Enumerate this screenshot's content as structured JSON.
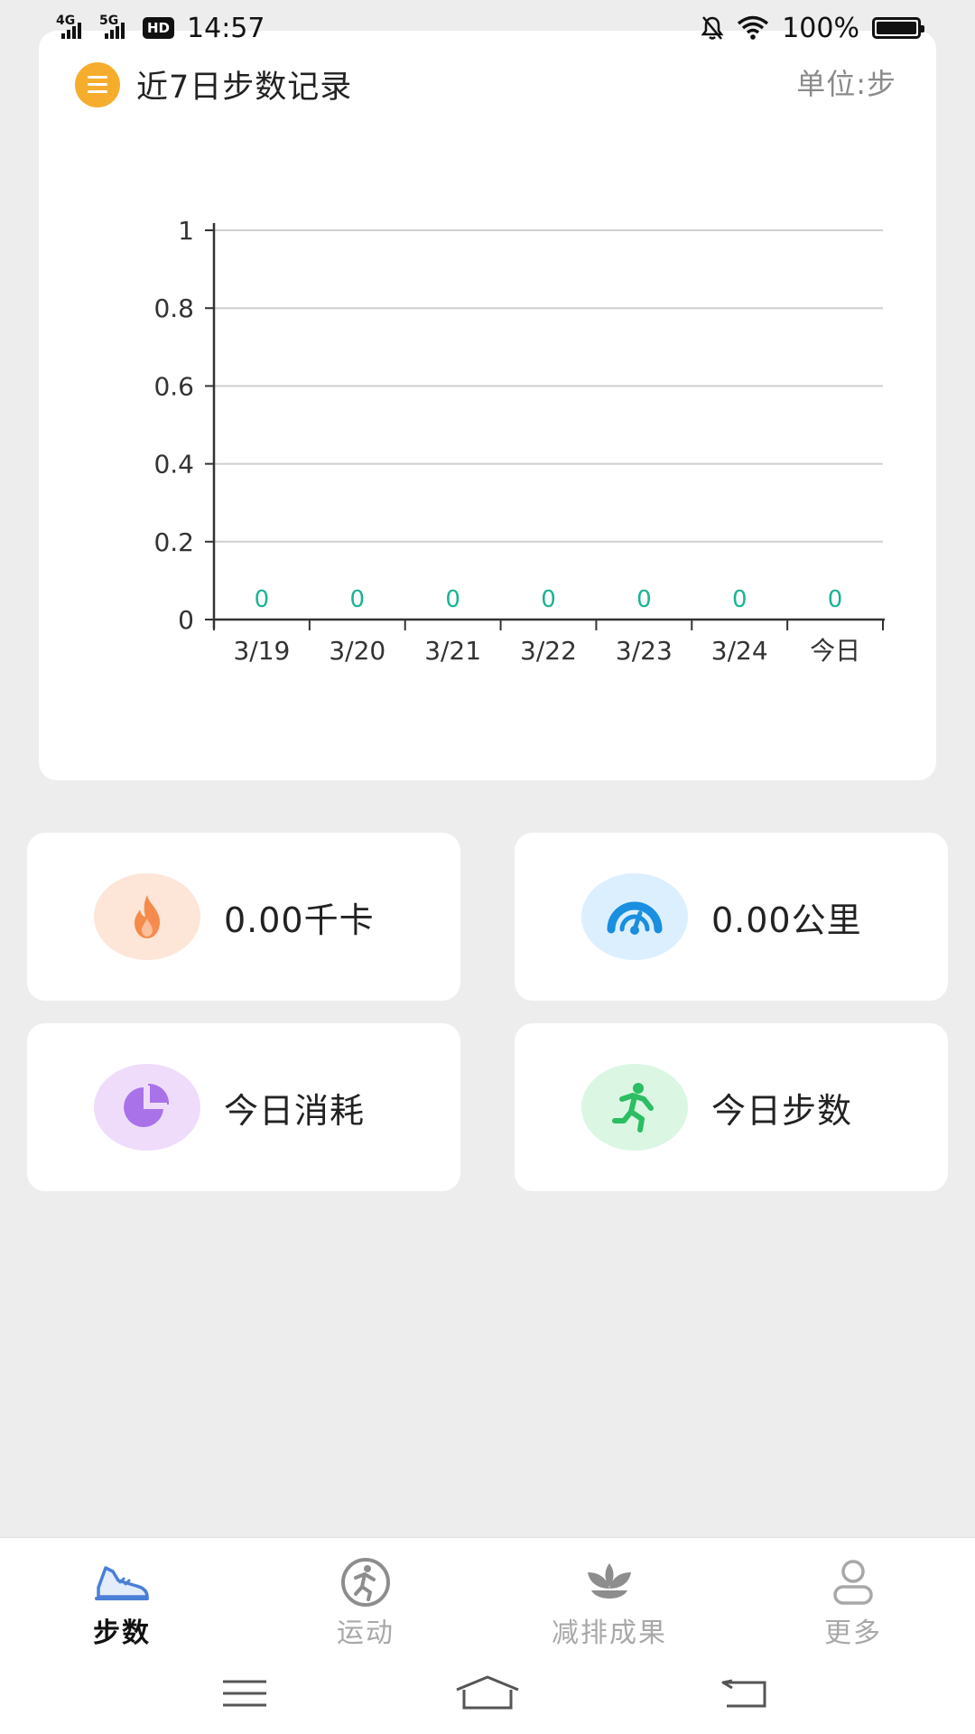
{
  "status_bar": {
    "net1": "4G",
    "net2": "5G",
    "hd": "HD",
    "time": "14:57",
    "battery": "100%"
  },
  "chart_card": {
    "title": "近7日步数记录",
    "unit": "单位:步"
  },
  "chart_data": {
    "type": "bar",
    "categories": [
      "3/19",
      "3/20",
      "3/21",
      "3/22",
      "3/23",
      "3/24",
      "今日"
    ],
    "values": [
      0,
      0,
      0,
      0,
      0,
      0,
      0
    ],
    "data_labels": [
      "0",
      "0",
      "0",
      "0",
      "0",
      "0",
      "0"
    ],
    "yticks": [
      "0",
      "0.2",
      "0.4",
      "0.6",
      "0.8",
      "1"
    ],
    "ylim": [
      0,
      1
    ],
    "grid": true,
    "label_color": "#1ab394"
  },
  "stats": {
    "calories": "0.00千卡",
    "distance": "0.00公里",
    "consumption": "今日消耗",
    "steps": "今日步数"
  },
  "tabs": [
    {
      "label": "步数",
      "icon": "shoe-icon",
      "active": true
    },
    {
      "label": "运动",
      "icon": "run-icon",
      "active": false
    },
    {
      "label": "减排成果",
      "icon": "leaf-icon",
      "active": false
    },
    {
      "label": "更多",
      "icon": "person-icon",
      "active": false
    }
  ],
  "colors": {
    "accent": "#4a7fd8",
    "calorie": "#f58b4c",
    "distance": "#1a8ee0",
    "consumption": "#a972e8",
    "steps": "#2dbd62"
  }
}
